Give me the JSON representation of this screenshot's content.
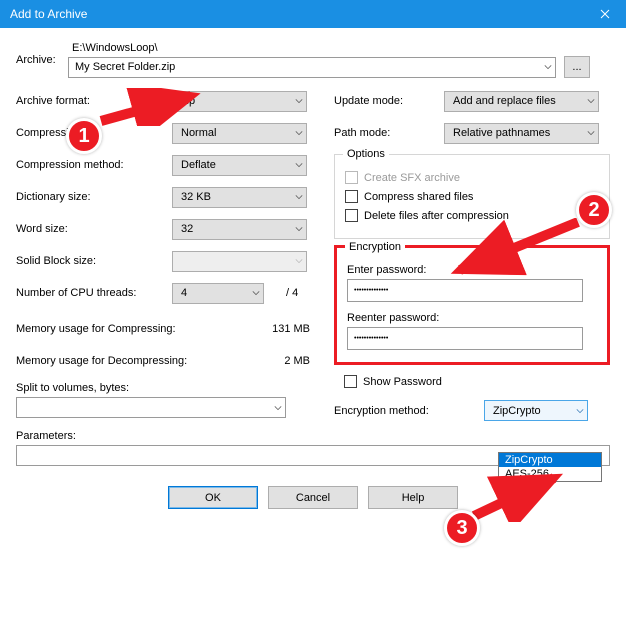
{
  "title": "Add to Archive",
  "archive": {
    "label": "Archive:",
    "path": "E:\\WindowsLoop\\",
    "filename": "My Secret Folder.zip",
    "browse": "..."
  },
  "left": {
    "format_label": "Archive format:",
    "format_value": "zip",
    "level_label": "Compressi",
    "level_value": "Normal",
    "method_label": "Compression method:",
    "method_value": "Deflate",
    "dict_label": "Dictionary size:",
    "dict_value": "32 KB",
    "word_label": "Word size:",
    "word_value": "32",
    "solid_label": "Solid Block size:",
    "solid_value": "",
    "threads_label": "Number of CPU threads:",
    "threads_value": "4",
    "threads_max": "/ 4",
    "mem_comp_label": "Memory usage for Compressing:",
    "mem_comp_value": "131 MB",
    "mem_decomp_label": "Memory usage for Decompressing:",
    "mem_decomp_value": "2 MB",
    "split_label": "Split to volumes, bytes:",
    "params_label": "Parameters:"
  },
  "right": {
    "update_label": "Update mode:",
    "update_value": "Add and replace files",
    "path_label": "Path mode:",
    "path_value": "Relative pathnames",
    "options_title": "Options",
    "opt_sfx": "Create SFX archive",
    "opt_shared": "Compress shared files",
    "opt_delete": "Delete files after compression",
    "enc_title": "Encryption",
    "enter_pwd": "Enter password:",
    "reenter_pwd": "Reenter password:",
    "pwd_mask": "••••••••••••••",
    "show_pwd": "Show Password",
    "enc_method_label": "Encryption method:",
    "enc_method_value": "ZipCrypto",
    "enc_options": [
      "ZipCrypto",
      "AES-256"
    ]
  },
  "buttons": {
    "ok": "OK",
    "cancel": "Cancel",
    "help": "Help"
  },
  "annotations": {
    "b1": "1",
    "b2": "2",
    "b3": "3"
  }
}
